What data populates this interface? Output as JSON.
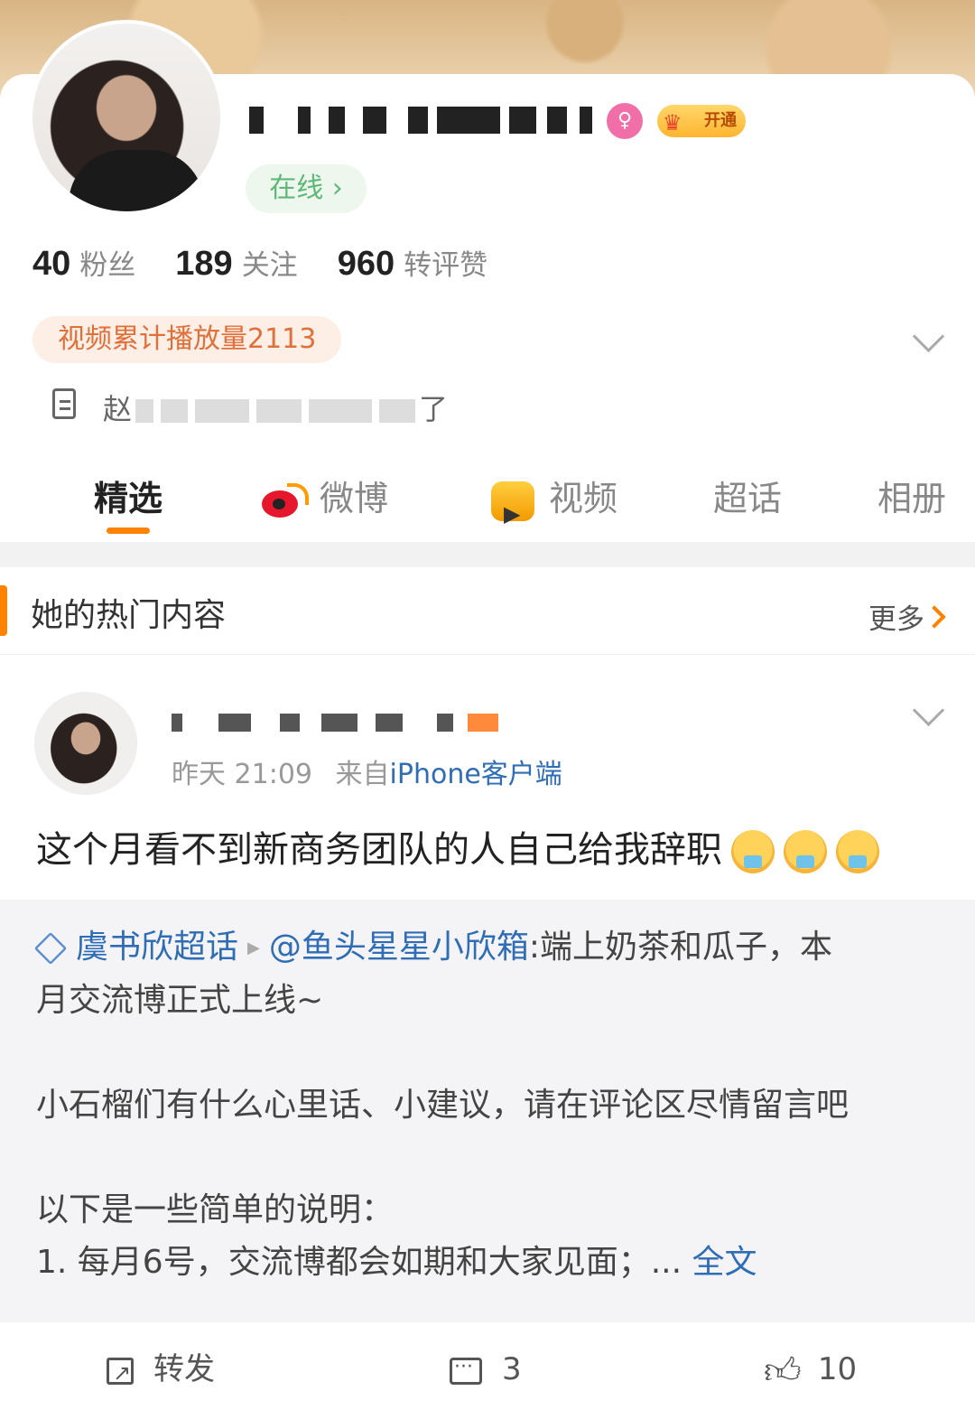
{
  "profile": {
    "online_label": "在线 ›",
    "vip_label": "开通",
    "stats": [
      {
        "num": "40",
        "label": "粉丝"
      },
      {
        "num": "189",
        "label": "关注"
      },
      {
        "num": "960",
        "label": "转评赞"
      }
    ],
    "video_badge": "视频累计播放量2113",
    "bio_prefix": "赵",
    "bio_suffix": "了"
  },
  "tabs": [
    {
      "label": "精选",
      "icon": ""
    },
    {
      "label": "微博",
      "icon": "weibo-icon"
    },
    {
      "label": "视频",
      "icon": "video-icon"
    },
    {
      "label": "超话",
      "icon": ""
    },
    {
      "label": "相册",
      "icon": ""
    }
  ],
  "section": {
    "title": "她的热门内容",
    "more": "更多"
  },
  "post": {
    "time": "昨天 21:09",
    "source_prefix": "来自",
    "source": "iPhone客户端",
    "text": "这个月看不到新商务团队的人自己给我辞职",
    "repost": {
      "topic": "虞书欣超话",
      "mention": "@鱼头星星小欣箱",
      "line1_rest": ":端上奶茶和瓜子，本",
      "line2": "月交流博正式上线~",
      "line3": "小石榴们有什么心里话、小建议，请在评论区尽情留言吧",
      "line4": "以下是一些简单的说明：",
      "line5": "1. 每月6号，交流博都会如期和大家见面；...",
      "full_text": "全文"
    },
    "actions": {
      "share": "转发",
      "comments": "3",
      "likes": "10"
    }
  },
  "colors": {
    "accent": "#ff8200",
    "link": "#2f6db5",
    "online": "#5fb878"
  }
}
